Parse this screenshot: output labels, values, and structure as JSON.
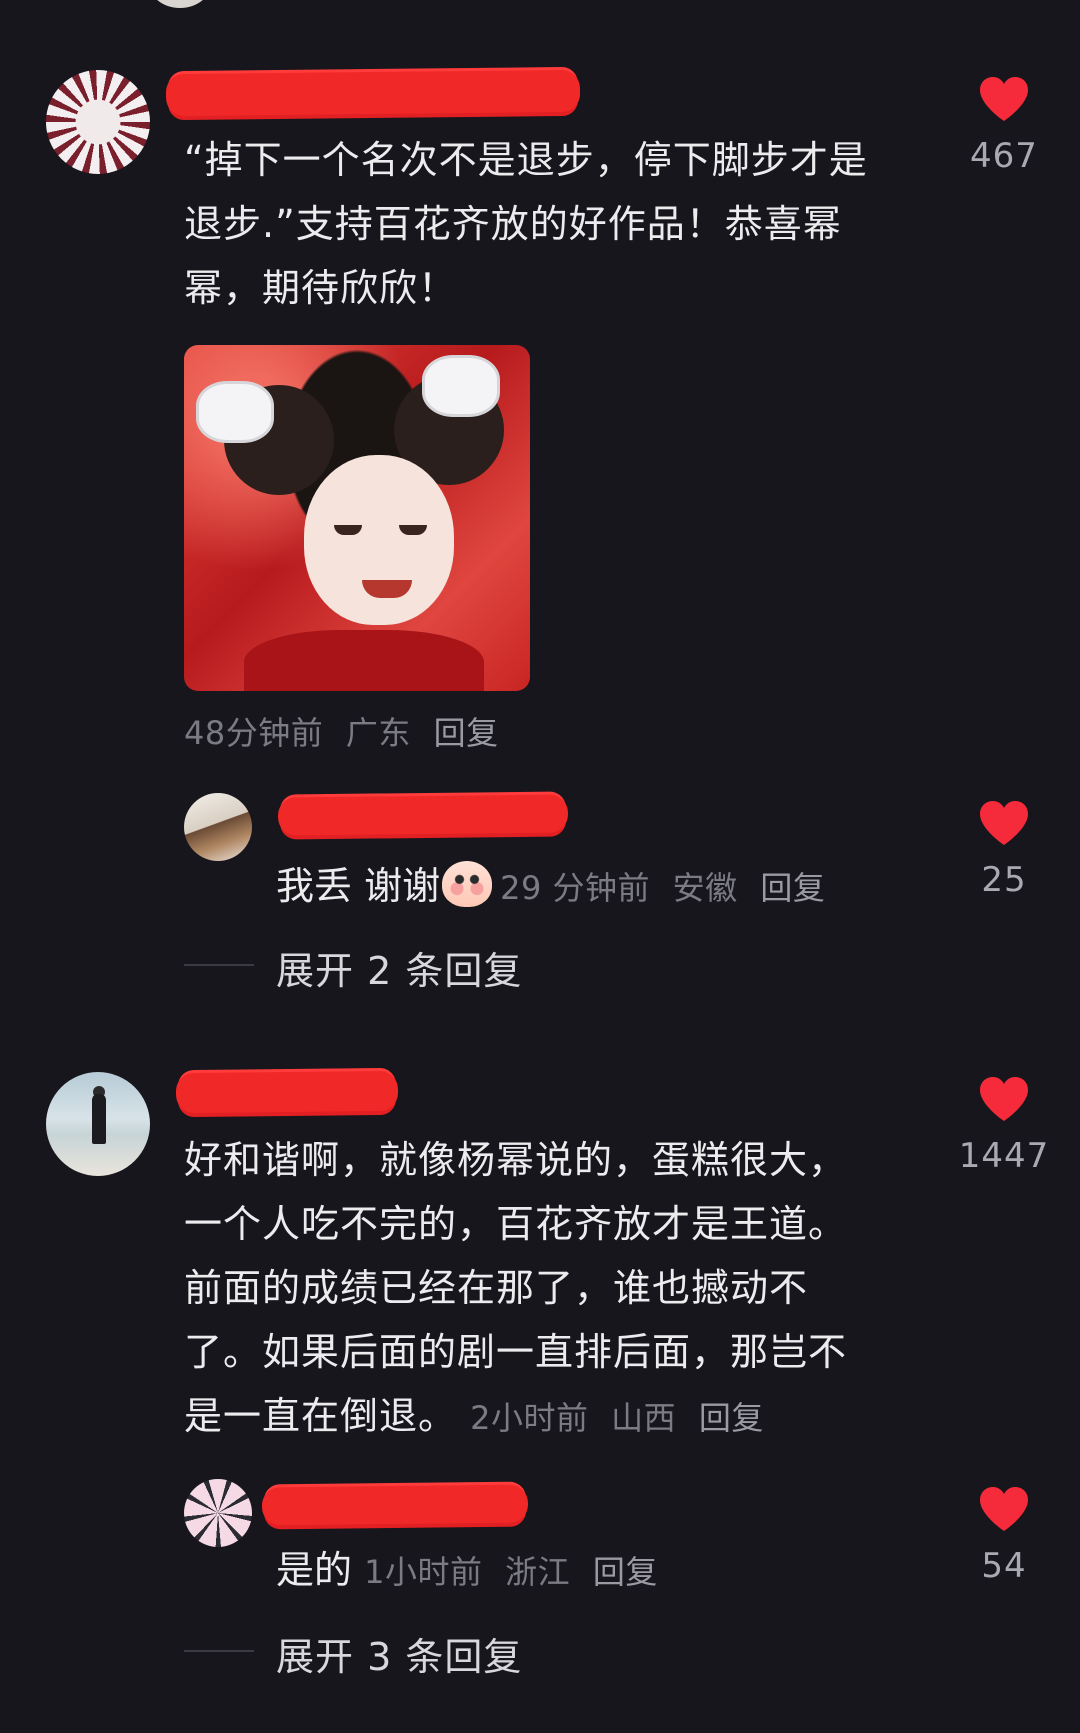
{
  "comments": [
    {
      "text_lines": [
        "“掉下一个名次不是退步，停下脚步才是",
        "退步.”支持百花齐放的好作品！恭喜幂",
        "幂，期待欣欣！"
      ],
      "time": "48分钟前",
      "location": "广东",
      "reply_label": "回复",
      "likes": "467",
      "replies": [
        {
          "text": "我丢 谢谢",
          "time": "29 分钟前",
          "location": "安徽",
          "reply_label": "回复",
          "likes": "25"
        }
      ],
      "expand_label": "展开 2 条回复"
    },
    {
      "text_lines": [
        "好和谐啊，就像杨幂说的，蛋糕很大，",
        "一个人吃不完的，百花齐放才是王道。",
        "前面的成绩已经在那了，谁也撼动不",
        "了。如果后面的剧一直排后面，那岂不",
        "是一直在倒退。"
      ],
      "time": "2小时前",
      "location": "山西",
      "reply_label": "回复",
      "likes": "1447",
      "replies": [
        {
          "text": "是的",
          "time": "1小时前",
          "location": "浙江",
          "reply_label": "回复",
          "likes": "54"
        }
      ],
      "expand_label": "展开 3 条回复"
    }
  ],
  "colors": {
    "background": "#17161c",
    "heart": "#f52a3a",
    "redaction": "#f02828"
  },
  "icons": {
    "like": "heart-icon",
    "emoji": "blush-face-emoji"
  }
}
